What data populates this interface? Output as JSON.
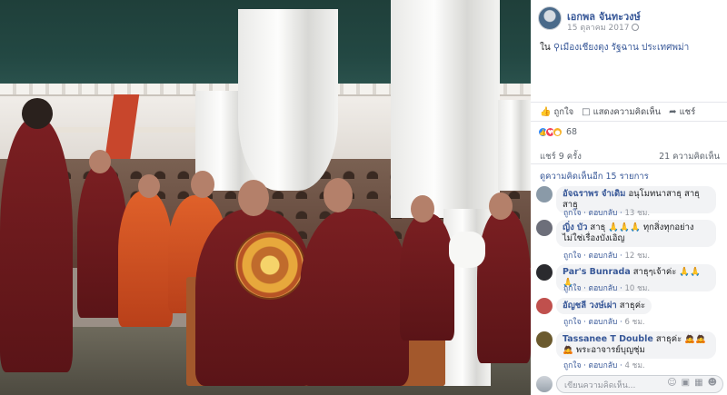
{
  "post": {
    "author": "เอกพล จันทะวงษ์",
    "date": "15 ตุลาคม 2017",
    "location_prefix": "ใน",
    "location": "เมืองเชียงตุง รัฐฉาน ประเทศพม่า"
  },
  "actions": {
    "like": "ถูกใจ",
    "comment": "แสดงความคิดเห็น",
    "share": "แชร์"
  },
  "reactions": {
    "count": "68",
    "icons": [
      "like-icon",
      "love-icon",
      "wow-icon"
    ]
  },
  "stats": {
    "shares": "แชร์ 9 ครั้ง",
    "comments": "21 ความคิดเห็น"
  },
  "more_comments": "ดูความคิดเห็นอีก 15 รายการ",
  "comments": [
    {
      "name": "อัจฉราพร จำเดิม",
      "text": "อนุโมทนาสาธุ สาธุ สาธุ",
      "like": "ถูกใจ",
      "reply": "ตอบกลับ",
      "time": "13 ชม.",
      "avatar_color": "#8a9aa8"
    },
    {
      "name": "ญิ่ง บัว",
      "text": "สาธุ 🙏🙏🙏 ทุกสิ่งทุกอย่างไม่ใช่เรื่องบังเอิญ",
      "like": "ถูกใจ",
      "reply": "ตอบกลับ",
      "time": "12 ชม.",
      "avatar_color": "#6d6f7a"
    },
    {
      "name": "Par's Bunrada",
      "text": "สาธุๆเจ้าค่ะ 🙏🙏🙏",
      "like": "ถูกใจ",
      "reply": "ตอบกลับ",
      "time": "10 ชม.",
      "avatar_color": "#2a2a2e"
    },
    {
      "name": "อัญชลี วงษ์เผ่า",
      "text": "สาธุค่ะ",
      "like": "ถูกใจ",
      "reply": "ตอบกลับ",
      "time": "6 ชม.",
      "avatar_color": "#c0504d"
    },
    {
      "name": "Tassanee T Double",
      "text": "สาธุค่ะ 🙇🙇🙇 พระอาจารย์บุญชุ่ม",
      "like": "ถูกใจ",
      "reply": "ตอบกลับ",
      "time": "4 ชม.",
      "avatar_color": "#6b5a2e"
    }
  ],
  "write": {
    "placeholder": "เขียนความคิดเห็น..."
  }
}
